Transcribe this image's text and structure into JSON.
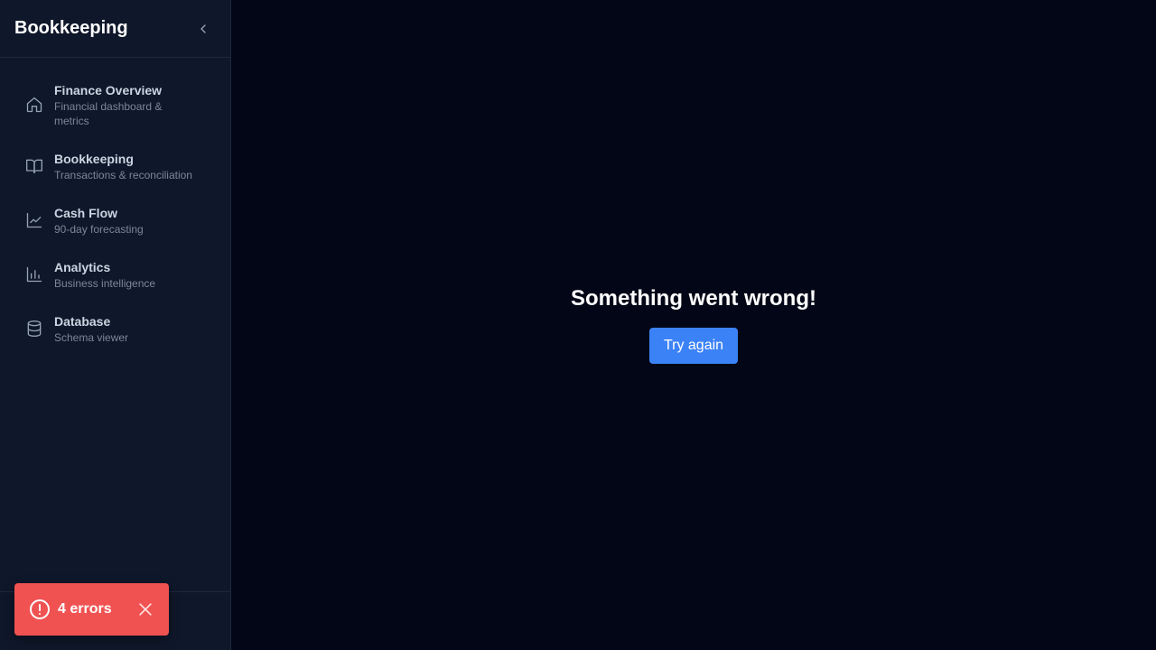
{
  "sidebar": {
    "title": "Bookkeeping",
    "collapse_icon": "chevron-left-icon",
    "items": [
      {
        "label": "Finance Overview",
        "description": "Financial dashboard & metrics",
        "icon": "home-icon"
      },
      {
        "label": "Bookkeeping",
        "description": "Transactions & reconciliation",
        "icon": "book-open-icon"
      },
      {
        "label": "Cash Flow",
        "description": "90-day forecasting",
        "icon": "line-chart-icon"
      },
      {
        "label": "Analytics",
        "description": "Business intelligence",
        "icon": "bar-chart-icon"
      },
      {
        "label": "Database",
        "description": "Schema viewer",
        "icon": "database-icon"
      }
    ]
  },
  "main": {
    "error_title": "Something went wrong!",
    "retry_label": "Try again"
  },
  "toast": {
    "label": "4 errors",
    "icon": "alert-circle-icon",
    "close_icon": "close-icon"
  },
  "colors": {
    "background": "#030617",
    "sidebar": "#0f172a",
    "accent": "#3b82f6",
    "error": "#f05252"
  }
}
